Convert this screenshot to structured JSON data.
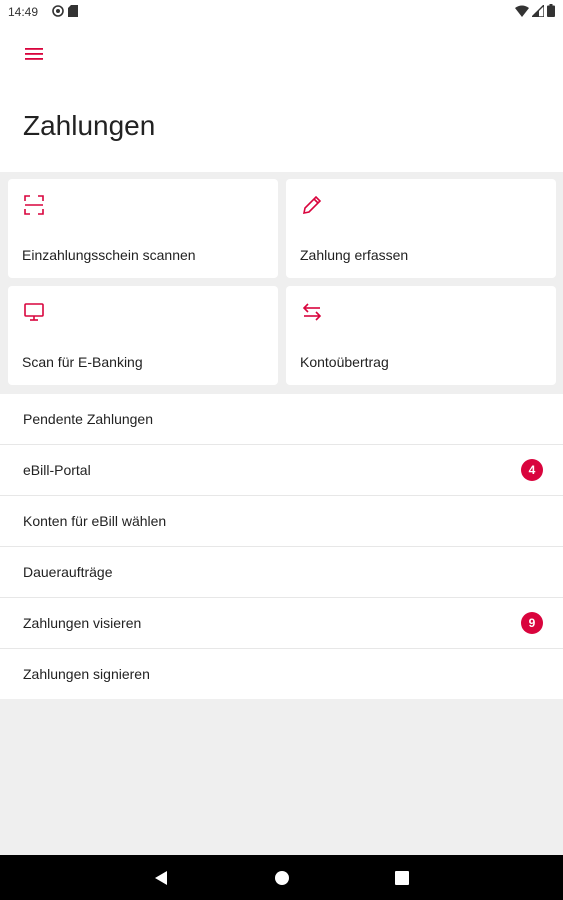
{
  "status_bar": {
    "time": "14:49",
    "icons": [
      "at-sign-icon",
      "sd-card-icon",
      "wifi-icon",
      "cell-signal-icon",
      "battery-icon"
    ]
  },
  "header": {
    "menu_icon": "hamburger-menu-icon",
    "title": "Zahlungen"
  },
  "tiles": [
    {
      "label": "Einzahlungsschein scannen",
      "icon": "scan-icon"
    },
    {
      "label": "Zahlung erfassen",
      "icon": "pencil-icon"
    },
    {
      "label": "Scan für E-Banking",
      "icon": "monitor-icon"
    },
    {
      "label": "Kontoübertrag",
      "icon": "transfer-arrows-icon"
    }
  ],
  "list": [
    {
      "label": "Pendente Zahlungen",
      "badge": ""
    },
    {
      "label": "eBill-Portal",
      "badge": "4"
    },
    {
      "label": "Konten für eBill wählen",
      "badge": ""
    },
    {
      "label": "Daueraufträge",
      "badge": ""
    },
    {
      "label": "Zahlungen visieren",
      "badge": "9"
    },
    {
      "label": "Zahlungen signieren",
      "badge": ""
    }
  ],
  "nav": [
    "back-icon",
    "home-icon",
    "recents-icon"
  ],
  "colors": {
    "accent": "#d9043d",
    "background": "#efefef",
    "surface": "#ffffff"
  }
}
